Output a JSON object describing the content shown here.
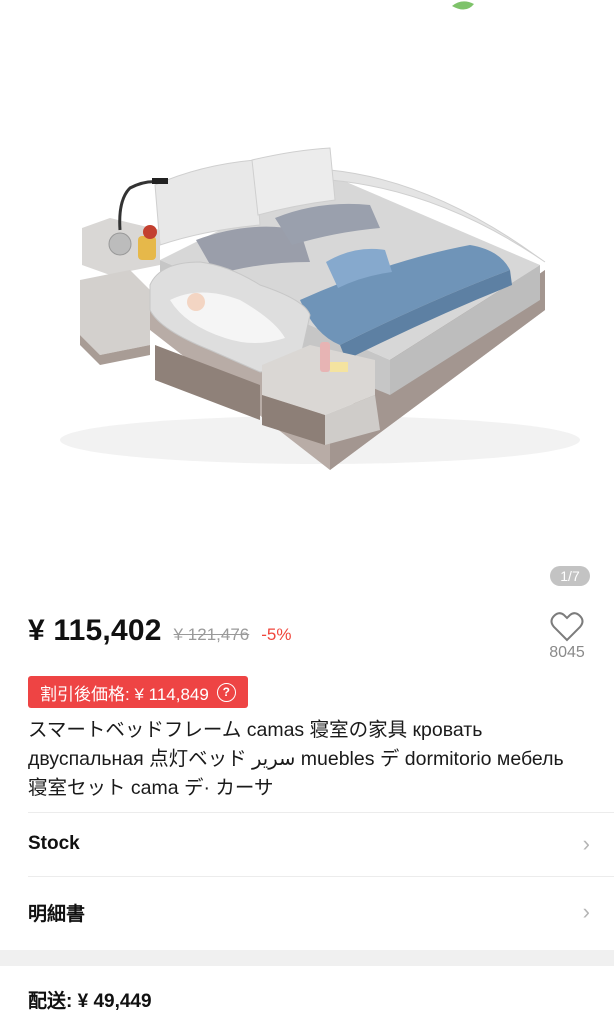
{
  "gallery": {
    "counter": "1/7",
    "image_alt": "smart bed with speaker headboard, side tables, baby crib and lamp"
  },
  "price": {
    "current": "¥ 115,402",
    "original": "¥ 121,476",
    "discount": "-5%"
  },
  "wishlist": {
    "icon": "heart-icon",
    "count": "8045"
  },
  "coupon": {
    "label": "割引後価格: ¥ 114,849",
    "help_icon": "?"
  },
  "product": {
    "title": "スマートベッドフレーム camas 寝室の家具 кровать двуспальная 点灯ベッド سرير muebles デ dormitorio мебель 寝室セット cama デ· カーサ"
  },
  "rows": [
    {
      "label": "Stock"
    },
    {
      "label": "明細書"
    }
  ],
  "shipping": {
    "label": "配送: ¥ 49,449"
  }
}
